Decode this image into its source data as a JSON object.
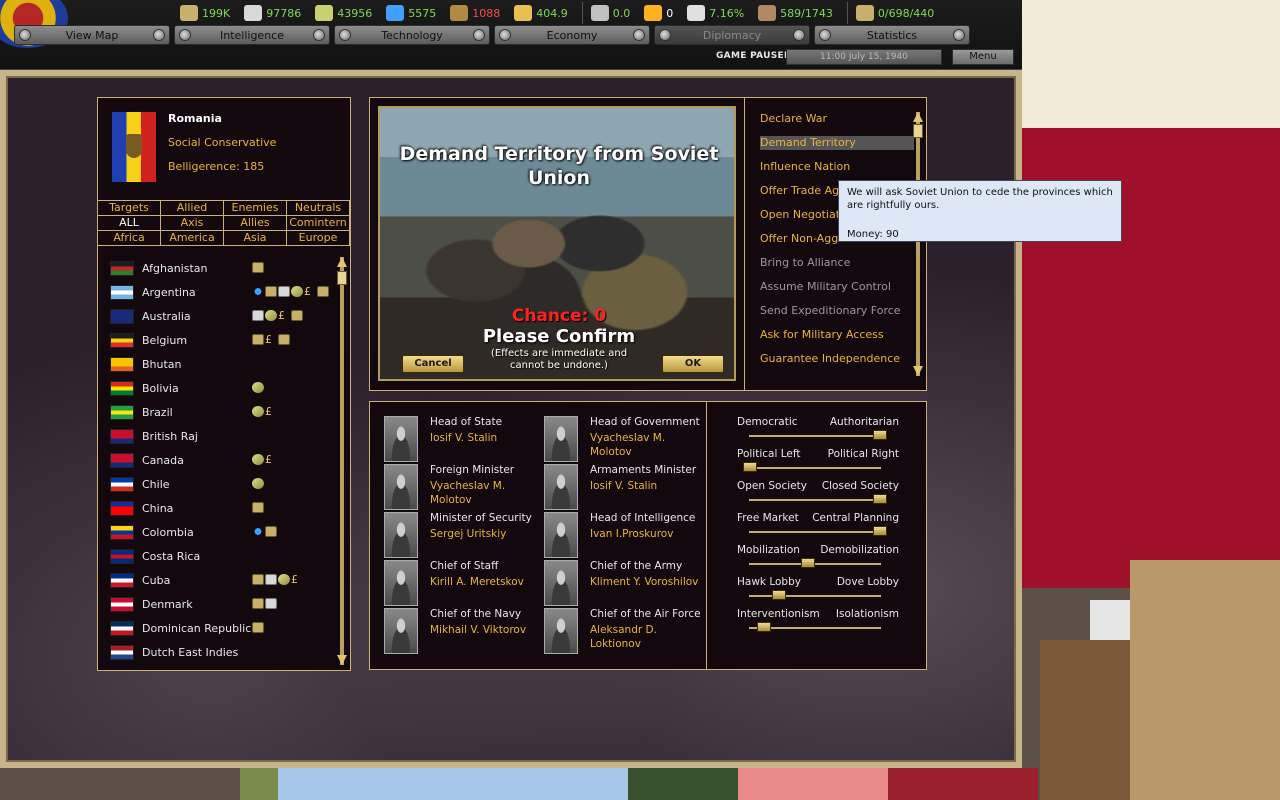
{
  "resources": [
    {
      "icon": "supplies-icon",
      "value": "199K",
      "color": "#7ed957"
    },
    {
      "icon": "metal-icon",
      "value": "97786",
      "color": "#7ed957"
    },
    {
      "icon": "energy-icon",
      "value": "43956",
      "color": "#7ed957"
    },
    {
      "icon": "oil-icon",
      "value": "5575",
      "color": "#7ed957"
    },
    {
      "icon": "rare-materials-icon",
      "value": "1088",
      "color": "#ff4a4a"
    },
    {
      "icon": "money-icon",
      "value": "404.9",
      "color": "#7ed957"
    },
    {
      "icon": "manpower-icon",
      "value": "0.0",
      "color": "#7ed957"
    },
    {
      "icon": "nuke-icon",
      "value": "0",
      "color": "#ffffff"
    },
    {
      "icon": "dissent-icon",
      "value": "7.16%",
      "color": "#7ed957"
    },
    {
      "icon": "transport-icon",
      "value": "589/1743",
      "color": "#7ed957"
    },
    {
      "icon": "convoy-icon",
      "value": "0/698/440",
      "color": "#7ed957"
    }
  ],
  "tabs": [
    {
      "label": "View Map",
      "disabled": false
    },
    {
      "label": "Intelligence",
      "disabled": false
    },
    {
      "label": "Technology",
      "disabled": false
    },
    {
      "label": "Economy",
      "disabled": false
    },
    {
      "label": "Diplomacy",
      "disabled": true
    },
    {
      "label": "Statistics",
      "disabled": false
    }
  ],
  "status": {
    "paused": "GAME PAUSED",
    "date": "11:00 July 15, 1940",
    "menu": "Menu"
  },
  "country": {
    "name": "Romania",
    "ideology": "Social Conservative",
    "belligerence": "Belligerence: 185",
    "flag_colors": [
      "#1f3fb0",
      "#f7d117",
      "#d0231f"
    ]
  },
  "filters": [
    "Targets",
    "Allied",
    "Enemies",
    "Neutrals",
    "ALL",
    "Axis",
    "Allies",
    "Comintern",
    "Africa",
    "America",
    "Asia",
    "Europe"
  ],
  "countries": [
    {
      "name": "Afghanistan",
      "flag": [
        "#1d1d1d",
        "#c62828",
        "#2e7d32"
      ],
      "icons": [
        "sup"
      ]
    },
    {
      "name": "Argentina",
      "flag": [
        "#74b4e4",
        "#ffffff",
        "#74b4e4"
      ],
      "icons": [
        "oil",
        "sup",
        "eng",
        "tri",
        "mon",
        "sup"
      ]
    },
    {
      "name": "Australia",
      "flag": [
        "#1a2a7a",
        "#1a2a7a",
        "#1a2a7a"
      ],
      "icons": [
        "eng",
        "tri",
        "mon",
        "sup"
      ]
    },
    {
      "name": "Belgium",
      "flag": [
        "#1d1d1d",
        "#f6d312",
        "#e52b2b"
      ],
      "icons": [
        "sup",
        "mon",
        "sup"
      ]
    },
    {
      "name": "Bhutan",
      "flag": [
        "#f8c300",
        "#f8c300",
        "#e8601c"
      ],
      "icons": []
    },
    {
      "name": "Bolivia",
      "flag": [
        "#d52b1e",
        "#f9e300",
        "#007934"
      ],
      "icons": [
        "tri"
      ]
    },
    {
      "name": "Brazil",
      "flag": [
        "#229e45",
        "#f8e509",
        "#229e45"
      ],
      "icons": [
        "tri",
        "mon"
      ]
    },
    {
      "name": "British Raj",
      "flag": [
        "#c8102e",
        "#c8102e",
        "#1a2a7a"
      ],
      "icons": []
    },
    {
      "name": "Canada",
      "flag": [
        "#c8102e",
        "#c8102e",
        "#1a2a7a"
      ],
      "icons": [
        "tri",
        "mon"
      ]
    },
    {
      "name": "Chile",
      "flag": [
        "#0039a6",
        "#ffffff",
        "#d52b1e"
      ],
      "icons": [
        "tri"
      ]
    },
    {
      "name": "China",
      "flag": [
        "#1a2a9a",
        "#fe0000",
        "#fe0000"
      ],
      "icons": [
        "sup"
      ]
    },
    {
      "name": "Colombia",
      "flag": [
        "#fcd116",
        "#003893",
        "#ce1126"
      ],
      "icons": [
        "oil",
        "sup"
      ]
    },
    {
      "name": "Costa Rica",
      "flag": [
        "#002b7f",
        "#ce1126",
        "#002b7f"
      ],
      "icons": []
    },
    {
      "name": "Cuba",
      "flag": [
        "#002a8f",
        "#ffffff",
        "#cf142b"
      ],
      "icons": [
        "sup",
        "eng",
        "tri",
        "mon"
      ]
    },
    {
      "name": "Denmark",
      "flag": [
        "#c60c30",
        "#ffffff",
        "#c60c30"
      ],
      "icons": [
        "sup",
        "eng"
      ]
    },
    {
      "name": "Dominican Republic",
      "flag": [
        "#002d62",
        "#ffffff",
        "#ce1126"
      ],
      "icons": [
        "sup"
      ]
    },
    {
      "name": "Dutch East Indies",
      "flag": [
        "#ae1c28",
        "#ffffff",
        "#21468b"
      ],
      "icons": []
    }
  ],
  "scene": {
    "title": "Demand Territory from Soviet Union",
    "chance": "Chance: 0",
    "confirm": "Please Confirm",
    "effects": "(Effects are immediate and cannot be undone.)",
    "cancel": "Cancel",
    "ok": "OK"
  },
  "actions": [
    {
      "label": "Declare War",
      "enabled": true
    },
    {
      "label": "Demand Territory",
      "enabled": true,
      "highlight": true
    },
    {
      "label": "Influence Nation",
      "enabled": true
    },
    {
      "label": "Offer Trade Agreement",
      "enabled": true
    },
    {
      "label": "Open Negotiations",
      "enabled": true
    },
    {
      "label": "Offer Non-Aggression Pact",
      "enabled": true
    },
    {
      "label": "Bring to Alliance",
      "enabled": false
    },
    {
      "label": "Assume Military Control",
      "enabled": false
    },
    {
      "label": "Send Expeditionary Force",
      "enabled": false
    },
    {
      "label": "Ask for Military Access",
      "enabled": true
    },
    {
      "label": "Guarantee Independence",
      "enabled": true
    }
  ],
  "tooltip": {
    "text": "We will ask Soviet Union to cede the provinces which are rightfully ours.",
    "money": "Money: 90"
  },
  "ministers": [
    {
      "title": "Head of State",
      "name": "Iosif V. Stalin"
    },
    {
      "title": "Head of Government",
      "name": "Vyacheslav M. Molotov"
    },
    {
      "title": "Foreign Minister",
      "name": "Vyacheslav M. Molotov"
    },
    {
      "title": "Armaments Minister",
      "name": "Iosif V. Stalin"
    },
    {
      "title": "Minister of Security",
      "name": "Sergej Uritskiy"
    },
    {
      "title": "Head of Intelligence",
      "name": "Ivan I.Proskurov"
    },
    {
      "title": "Chief of Staff",
      "name": "Kirill A. Meretskov"
    },
    {
      "title": "Chief of the Army",
      "name": "Kliment Y. Voroshilov"
    },
    {
      "title": "Chief of the Navy",
      "name": "Mikhail V. Viktorov"
    },
    {
      "title": "Chief of the Air Force",
      "name": "Aleksandr D. Loktionov"
    }
  ],
  "policies": [
    {
      "left": "Democratic",
      "right": "Authoritarian",
      "level": 10,
      "max": 10
    },
    {
      "left": "Political Left",
      "right": "Political Right",
      "level": 1,
      "max": 10
    },
    {
      "left": "Open Society",
      "right": "Closed Society",
      "level": 10,
      "max": 10
    },
    {
      "left": "Free Market",
      "right": "Central Planning",
      "level": 10,
      "max": 10
    },
    {
      "left": "Mobilization",
      "right": "Demobilization",
      "level": 5,
      "max": 10
    },
    {
      "left": "Hawk Lobby",
      "right": "Dove Lobby",
      "level": 3,
      "max": 10
    },
    {
      "left": "Interventionism",
      "right": "Isolationism",
      "level": 2,
      "max": 10
    }
  ]
}
